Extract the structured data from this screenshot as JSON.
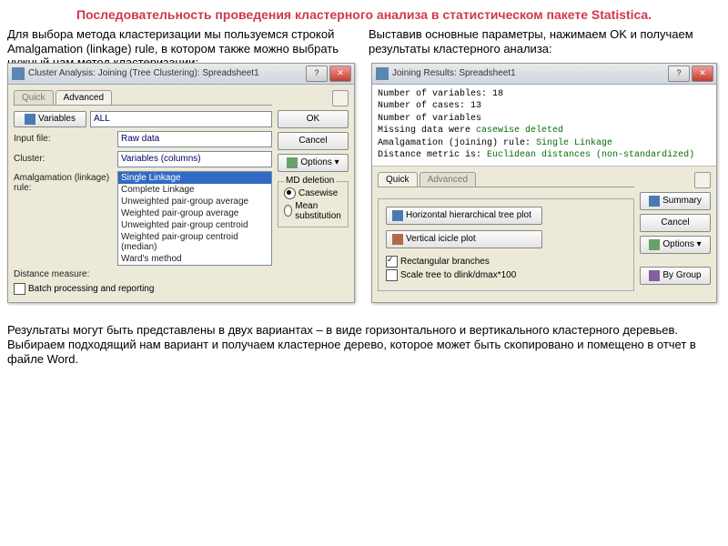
{
  "title": "Последовательность проведения кластерного анализа в статистическом пакете Statistica.",
  "intro": {
    "left": "Для выбора метода кластеризации мы пользуемся строкой Amalgamation (linkage) rule, в котором также можно выбрать нужный нам метод кластеризации:",
    "right": "Выставив основные параметры, нажимаем OK и получаем результаты кластерного анализа:"
  },
  "dlg1": {
    "title": "Cluster Analysis: Joining (Tree Clustering): Spreadsheet1",
    "tabs": {
      "quick": "Quick",
      "advanced": "Advanced"
    },
    "variablesBtn": "Variables",
    "variablesVal": "ALL",
    "inputFileLbl": "Input file:",
    "inputFileVal": "Raw data",
    "clusterLbl": "Cluster:",
    "clusterVal": "Variables (columns)",
    "amalgLbl": "Amalgamation (linkage) rule:",
    "amalgSel": "Single Linkage",
    "amalgOpts": [
      "Complete Linkage",
      "Unweighted pair-group average",
      "Weighted pair-group average",
      "Unweighted pair-group centroid",
      "Weighted pair-group centroid (median)",
      "Ward's method"
    ],
    "distLbl": "Distance measure:",
    "batchCb": "Batch processing and reporting",
    "ok": "OK",
    "cancel": "Cancel",
    "options": "Options",
    "mdGroup": "MD deletion",
    "mdCase": "Casewise",
    "mdMean": "Mean substitution"
  },
  "dlg2": {
    "title": "Joining Results: Spreadsheet1",
    "info1": "Number of variables: 18",
    "info2": "Number of cases: 13",
    "info3": "Number of variables",
    "info4a": "Missing data were ",
    "info4b": "casewise deleted",
    "info5a": "Amalgamation (joining) rule: ",
    "info5b": "Single Linkage",
    "info6a": "Distance metric is: ",
    "info6b": "Euclidean distances (non-standardized)",
    "tabs": {
      "quick": "Quick",
      "advanced": "Advanced"
    },
    "btnH": "Horizontal hierarchical tree plot",
    "btnV": "Vertical icicle plot",
    "cbRect": "Rectangular branches",
    "cbScale": "Scale tree to dlink/dmax*100",
    "summary": "Summary",
    "cancel": "Cancel",
    "options": "Options",
    "bygroup": "By Group"
  },
  "footer": "Результаты могут быть представлены в двух вариантах – в виде горизонтального и вертикального кластерного деревьев. Выбираем подходящий нам вариант и получаем кластерное дерево, которое может быть скопировано и помещено в отчет в файле Word."
}
